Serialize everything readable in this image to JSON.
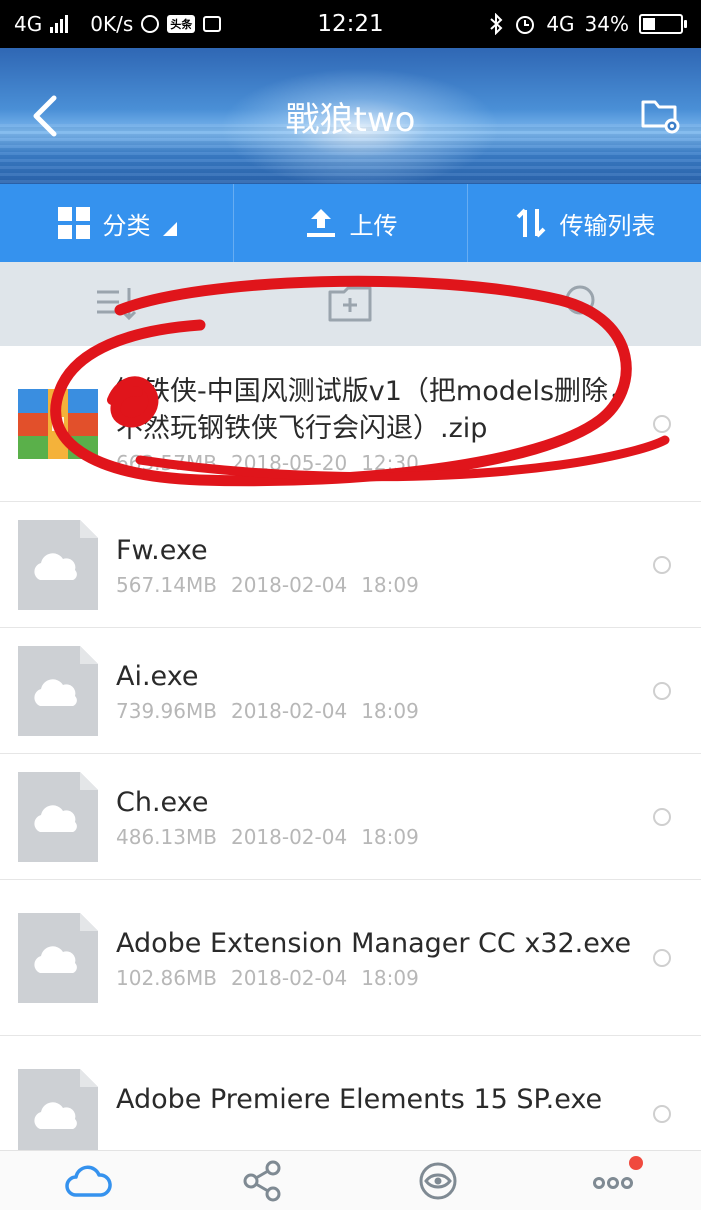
{
  "status_bar": {
    "network": "4G",
    "speed": "0K/s",
    "app_badge": "头条",
    "time": "12:21",
    "network_right": "4G",
    "battery_percent": "34%",
    "battery_level": 0.34
  },
  "header": {
    "title": "戰狼two",
    "back_icon": "chevron-left-icon",
    "folder_settings_icon": "folder-settings-icon"
  },
  "toolbar": {
    "category_label": "分类",
    "upload_label": "上传",
    "transfer_label": "传输列表"
  },
  "action_bar": {
    "sort_icon": "sort-icon",
    "new_folder_icon": "add-folder-icon",
    "search_icon": "search-icon"
  },
  "files": [
    {
      "name": "钢铁侠-中国风测试版v1（把models删除，不然玩钢铁侠飞行会闪退）.zip",
      "size": "663.57MB",
      "date": "2018-05-20",
      "time": "12:30",
      "type": "zip"
    },
    {
      "name": "Fw.exe",
      "size": "567.14MB",
      "date": "2018-02-04",
      "time": "18:09",
      "type": "exe"
    },
    {
      "name": "Ai.exe",
      "size": "739.96MB",
      "date": "2018-02-04",
      "time": "18:09",
      "type": "exe"
    },
    {
      "name": "Ch.exe",
      "size": "486.13MB",
      "date": "2018-02-04",
      "time": "18:09",
      "type": "exe"
    },
    {
      "name": "Adobe Extension Manager CC x32.exe",
      "size": "102.86MB",
      "date": "2018-02-04",
      "time": "18:09",
      "type": "exe"
    },
    {
      "name": "Adobe Premiere Elements 15 SP.exe",
      "size": "",
      "date": "",
      "time": "",
      "type": "exe"
    }
  ],
  "bottom_nav": {
    "items": [
      "cloud-icon",
      "share-icon",
      "eye-icon",
      "more-icon"
    ],
    "active_color": "#3592ee",
    "badge_color": "#f04a3e"
  },
  "colors": {
    "toolbar_bg": "#3592ee",
    "action_bar_bg": "#dfe5ea",
    "annotation": "#e0151b"
  }
}
